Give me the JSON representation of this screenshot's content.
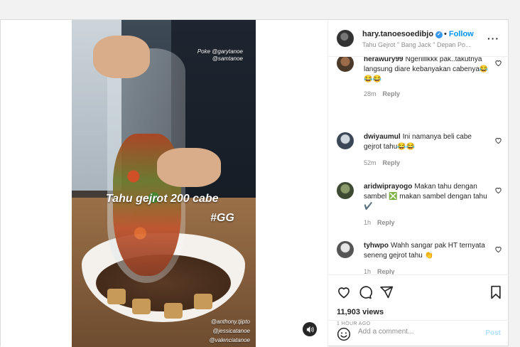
{
  "post": {
    "username": "hary.tanoesoedibjo",
    "follow_label": "Follow",
    "location": "Tahu Gejrot \" Bang Jack \" Depan Po...",
    "views": "11,903 views",
    "time": "1 HOUR AGO",
    "add_comment_placeholder": "Add a comment...",
    "post_label": "Post"
  },
  "video": {
    "poke_line1": "Poke @garytanoe",
    "poke_line2": "@samtanoe",
    "caption_line1": "Tahu gejrot 200 cabe",
    "caption_line2": "#GG",
    "tag1": "@anthony.tjipto",
    "tag2": "@jessicatanoe",
    "tag3": "@valenciatanoe"
  },
  "comments": [
    {
      "user": "herawury99",
      "text": "Ngerilllkkk pak..takutnya langsung diare kebanyakan cabenya😂😂😂",
      "age": "28m",
      "reply": "Reply"
    },
    {
      "user": "dwiyaumul",
      "text": "Ini namanya beli cabe gejrot tahu😂😂",
      "age": "52m",
      "reply": "Reply"
    },
    {
      "user": "aridwiprayogo",
      "text": "Makan tahu dengan sambel ❎ makan sambel dengan tahu ✔️",
      "age": "1h",
      "reply": "Reply"
    },
    {
      "user": "tyhwpo",
      "text": "Wahh sangar pak HT ternyata seneng gejrot tahu 👏",
      "age": "1h",
      "reply": "Reply"
    }
  ],
  "icons": {
    "like": "heart-icon",
    "comment": "comment-icon",
    "share": "share-icon",
    "save": "bookmark-icon",
    "more": "more-icon",
    "sound": "sound-icon",
    "emoji": "emoji-icon",
    "verified": "verified-badge-icon"
  },
  "colors": {
    "accent": "#0095f6",
    "verified": "#3897f0",
    "muted": "#8e8e8e",
    "post_disabled": "#b2dffc"
  }
}
